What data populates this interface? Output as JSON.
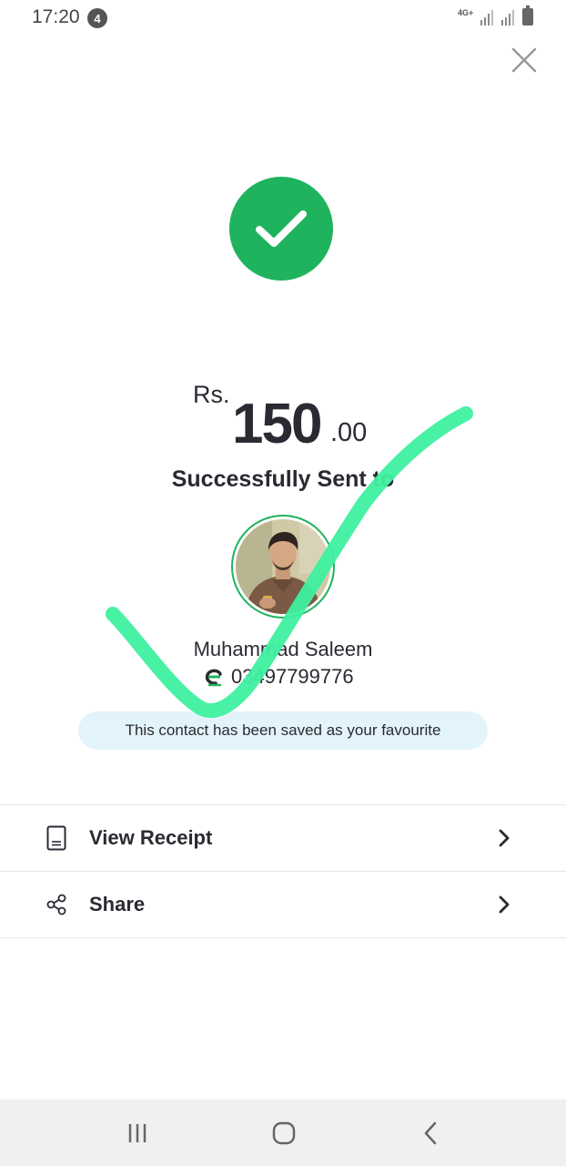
{
  "status_bar": {
    "time": "17:20",
    "notification_count": "4",
    "network": "4G+"
  },
  "icons": {
    "close": "close-icon",
    "success": "checkmark-circle-icon",
    "wallet": "wallet-brand-icon",
    "receipt": "receipt-icon",
    "share": "share-icon",
    "chevron": "chevron-right-icon"
  },
  "transaction": {
    "currency": "Rs.",
    "amount_whole": "150",
    "amount_decimal": ".00",
    "status_text": "Successfully Sent to"
  },
  "recipient": {
    "name": "Muhammad Saleem",
    "phone": "03497799776"
  },
  "favourite_message": "This contact has been saved as your favourite",
  "actions": [
    {
      "label": "View Receipt",
      "icon": "receipt-icon"
    },
    {
      "label": "Share",
      "icon": "share-icon"
    }
  ],
  "colors": {
    "success_green": "#1fb35d",
    "text_dark": "#2a2a33",
    "banner_bg": "#e3f3fa",
    "scribble": "#3ff0a0"
  }
}
